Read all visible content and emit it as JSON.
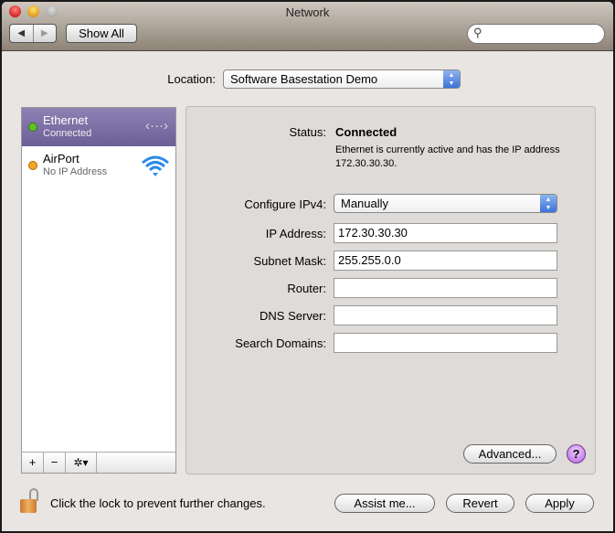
{
  "window": {
    "title": "Network"
  },
  "toolbar": {
    "back": "◀",
    "forward": "▶",
    "show_all": "Show All",
    "search_placeholder": ""
  },
  "location": {
    "label": "Location:",
    "value": "Software Basestation Demo"
  },
  "services": [
    {
      "name": "Ethernet",
      "status": "Connected",
      "dot": "#4caf20",
      "icon": "‹···›"
    },
    {
      "name": "AirPort",
      "status": "No IP Address",
      "dot": "#f0a020",
      "icon": "wifi"
    }
  ],
  "list_bar": {
    "add": "+",
    "remove": "−",
    "gear": "✲▾"
  },
  "detail": {
    "status_label": "Status:",
    "status_value": "Connected",
    "status_desc": "Ethernet is currently active and has the IP address 172.30.30.30.",
    "configure_label": "Configure IPv4:",
    "configure_value": "Manually",
    "ip_label": "IP Address:",
    "ip_value": "172.30.30.30",
    "subnet_label": "Subnet Mask:",
    "subnet_value": "255.255.0.0",
    "router_label": "Router:",
    "router_value": "",
    "dns_label": "DNS Server:",
    "dns_value": "",
    "search_label": "Search Domains:",
    "search_value": "",
    "advanced": "Advanced...",
    "help": "?"
  },
  "footer": {
    "lock_text": "Click the lock to prevent further changes.",
    "assist": "Assist me...",
    "revert": "Revert",
    "apply": "Apply"
  }
}
